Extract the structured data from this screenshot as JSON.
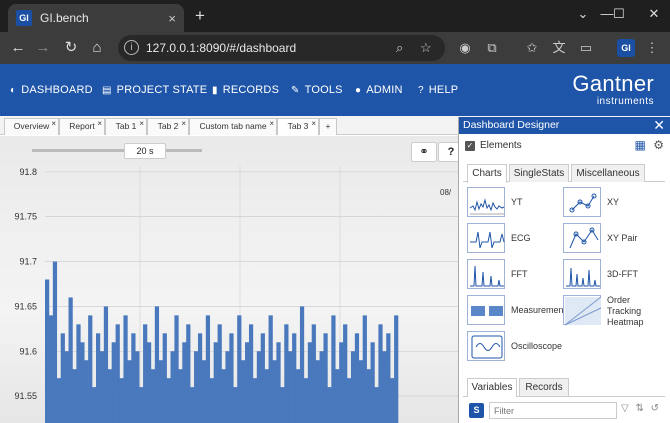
{
  "browser": {
    "tab_title": "GI.bench",
    "favicon_text": "GI",
    "close_glyph": "×",
    "new_tab_glyph": "+",
    "url": "127.0.0.1:8090/#/dashboard",
    "profile_text": "GI",
    "icons": [
      "back-icon",
      "forward-icon",
      "reload-icon",
      "home-icon",
      "info-icon",
      "zoom-icon",
      "star-icon",
      "extension-icon",
      "puzzle-icon",
      "bookmark-icon",
      "translate-icon",
      "cast-icon",
      "menu-icon"
    ]
  },
  "nav": {
    "items": [
      {
        "label": "DASHBOARD",
        "icon": "dashboard-icon"
      },
      {
        "label": "PROJECT STATE",
        "icon": "storage-icon"
      },
      {
        "label": "RECORDS",
        "icon": "file-icon"
      },
      {
        "label": "TOOLS",
        "icon": "wrench-icon"
      },
      {
        "label": "ADMIN",
        "icon": "user-icon"
      },
      {
        "label": "HELP",
        "icon": "question-icon"
      }
    ],
    "logo_big": "Gantner",
    "logo_small": "instruments"
  },
  "dashboard_tabs": [
    "Overview",
    "Report",
    "Tab 1",
    "Tab 2",
    "Custom tab name",
    "Tab 3",
    "+"
  ],
  "chart": {
    "time_window": "20 s",
    "date_stamp": "08/",
    "help_glyph": "?"
  },
  "chart_data": {
    "type": "bar",
    "ylim": [
      91.52,
      91.84
    ],
    "yticks": [
      "91.8",
      "91.75",
      "91.7",
      "91.65",
      "91.6",
      "91.55"
    ],
    "values": [
      91.68,
      91.64,
      91.7,
      91.57,
      91.62,
      91.6,
      91.66,
      91.58,
      91.63,
      91.61,
      91.59,
      91.64,
      91.56,
      91.62,
      91.6,
      91.65,
      91.58,
      91.61,
      91.63,
      91.57,
      91.64,
      91.59,
      91.62,
      91.6,
      91.56,
      91.63,
      91.61,
      91.58,
      91.65,
      91.59,
      91.62,
      91.57,
      91.6,
      91.64,
      91.58,
      91.61,
      91.63,
      91.56,
      91.6,
      91.62,
      91.59,
      91.64,
      91.57,
      91.61,
      91.63,
      91.58,
      91.6,
      91.62,
      91.56,
      91.64,
      91.59,
      91.61,
      91.63,
      91.57,
      91.6,
      91.62,
      91.58,
      91.64,
      91.59,
      91.61,
      91.56,
      91.63,
      91.6,
      91.62,
      91.58,
      91.65,
      91.57,
      91.61,
      91.63,
      91.59,
      91.6,
      91.62,
      91.56,
      91.64,
      91.58,
      91.61,
      91.63,
      91.57,
      91.6,
      91.62,
      91.59,
      91.64,
      91.58,
      91.61,
      91.56,
      91.63,
      91.6,
      91.62,
      91.57,
      91.64
    ],
    "color": "#4a78bd"
  },
  "designer": {
    "title": "Dashboard Designer",
    "close_glyph": "✕",
    "elements_label": "Elements",
    "tabs": [
      "Charts",
      "SingleStats",
      "Miscellaneous"
    ],
    "items": [
      "YT",
      "XY",
      "ECG",
      "XY Pair",
      "FFT",
      "3D-FFT",
      "Measurement",
      "Order Tracking Heatmap",
      "Oscilloscope"
    ],
    "var_tabs": [
      "Variables",
      "Records"
    ],
    "s_label": "S",
    "filter_placeholder": "Filter"
  }
}
